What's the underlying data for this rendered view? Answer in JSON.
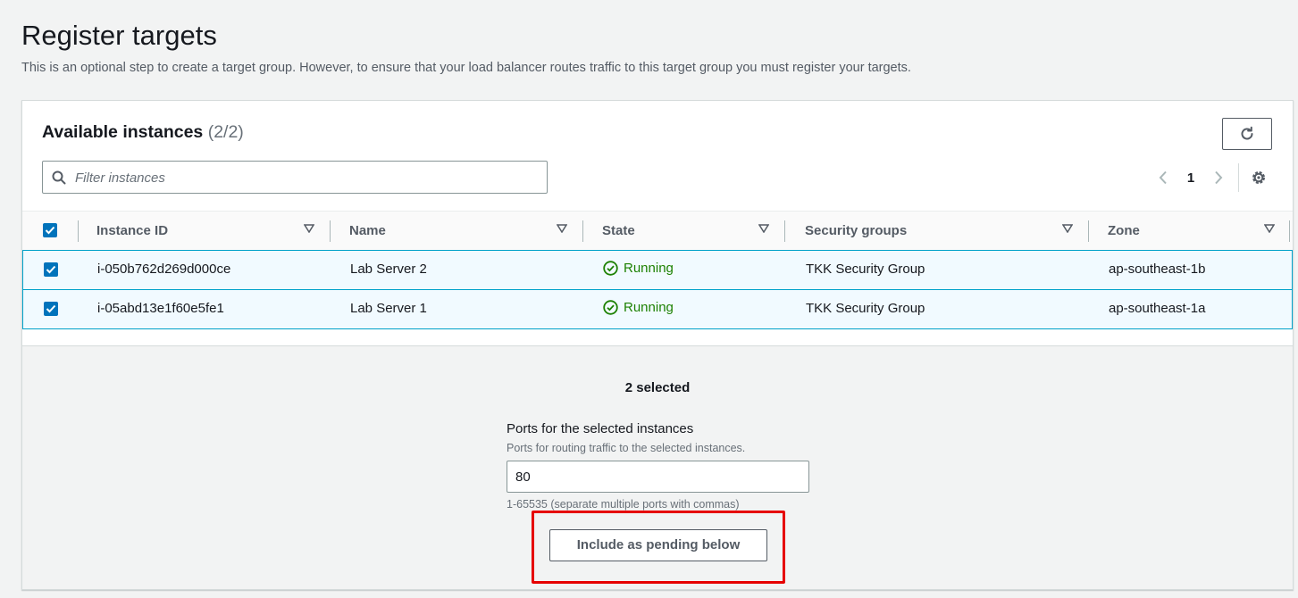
{
  "page": {
    "title": "Register targets",
    "description": "This is an optional step to create a target group. However, to ensure that your load balancer routes traffic to this target group you must register your targets."
  },
  "instances_panel": {
    "title": "Available instances",
    "count": "(2/2)",
    "filter_placeholder": "Filter instances",
    "page_number": "1",
    "columns": [
      "Instance ID",
      "Name",
      "State",
      "Security groups",
      "Zone"
    ],
    "rows": [
      {
        "instance_id": "i-050b762d269d000ce",
        "name": "Lab Server 2",
        "state": "Running",
        "security_groups": "TKK Security Group",
        "zone": "ap-southeast-1b",
        "checked": true
      },
      {
        "instance_id": "i-05abd13e1f60e5fe1",
        "name": "Lab Server 1",
        "state": "Running",
        "security_groups": "TKK Security Group",
        "zone": "ap-southeast-1a",
        "checked": true
      }
    ]
  },
  "selection": {
    "count_label": "2 selected",
    "ports_label": "Ports for the selected instances",
    "ports_description": "Ports for routing traffic to the selected instances.",
    "ports_value": "80",
    "ports_hint": "1-65535 (separate multiple ports with commas)",
    "include_button": "Include as pending below"
  },
  "colors": {
    "accent": "#0073bb",
    "running": "#1d8102",
    "highlight": "#e60000"
  }
}
